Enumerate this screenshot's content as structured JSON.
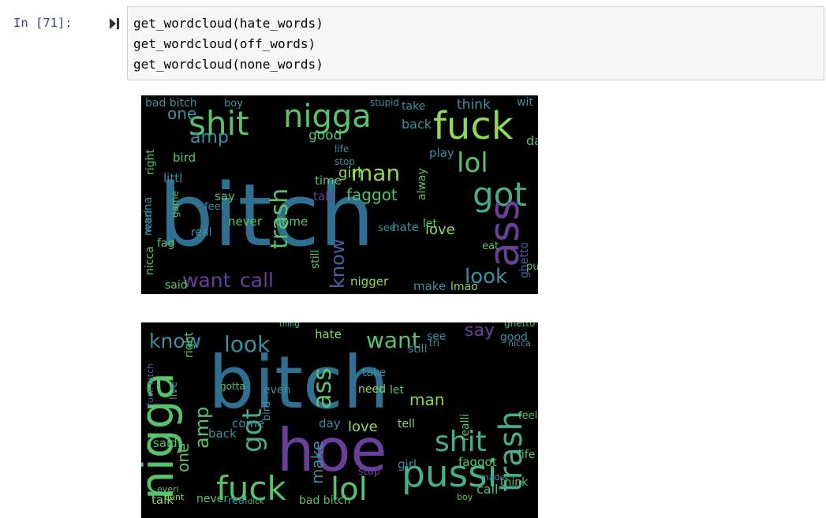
{
  "cell": {
    "prompt": "In [71]:",
    "run_icon": "step-run-icon",
    "code_lines": [
      "get_wordcloud(hate_words)",
      "get_wordcloud(off_words)",
      "get_wordcloud(none_words)"
    ]
  },
  "colors": {
    "prompt": "#303f9f",
    "cloud_background": "#000000",
    "palette": [
      "#2f6f8f",
      "#3b8fa2",
      "#58c26c",
      "#8fd85a",
      "#6a3f9a",
      "#3c2a6b",
      "#45b088",
      "#4a5fa0"
    ]
  },
  "clouds": [
    {
      "words": [
        {
          "text": "bitch",
          "c": 0
        },
        {
          "text": "hoe",
          "c": 3
        },
        {
          "text": "pussi",
          "c": 7
        },
        {
          "text": "shit",
          "c": 2
        },
        {
          "text": "nigga",
          "c": 2
        },
        {
          "text": "fuck",
          "c": 3
        },
        {
          "text": "lol",
          "c": 2
        },
        {
          "text": "got",
          "c": 6
        },
        {
          "text": "ass",
          "c": 4
        },
        {
          "text": "trash",
          "c": 2
        },
        {
          "text": "man",
          "c": 3
        },
        {
          "text": "look",
          "c": 1
        },
        {
          "text": "know",
          "c": 7
        },
        {
          "text": "want",
          "c": 4
        },
        {
          "text": "call",
          "c": 4
        },
        {
          "text": "amp",
          "c": 1
        },
        {
          "text": "one",
          "c": 1
        },
        {
          "text": "faggot",
          "c": 2
        },
        {
          "text": "love",
          "c": 3
        },
        {
          "text": "nigger",
          "c": 3
        },
        {
          "text": "make",
          "c": 1
        },
        {
          "text": "lmao",
          "c": 3
        },
        {
          "text": "hate",
          "c": 1
        },
        {
          "text": "girl",
          "c": 3
        },
        {
          "text": "good",
          "c": 2
        },
        {
          "text": "bird",
          "c": 2
        },
        {
          "text": "said",
          "c": 2
        },
        {
          "text": "play",
          "c": 1
        },
        {
          "text": "day",
          "c": 2
        },
        {
          "text": "real",
          "c": 1
        },
        {
          "text": "littl",
          "c": 1
        },
        {
          "text": "bad bitch",
          "c": 1
        },
        {
          "text": "think",
          "c": 1
        },
        {
          "text": "wit",
          "c": 1
        },
        {
          "text": "take",
          "c": 1
        },
        {
          "text": "back",
          "c": 1
        },
        {
          "text": "say",
          "c": 2
        },
        {
          "text": "time",
          "c": 2
        },
        {
          "text": "never",
          "c": 2
        },
        {
          "text": "come",
          "c": 2
        },
        {
          "text": "talk",
          "c": 4
        },
        {
          "text": "fag",
          "c": 2
        },
        {
          "text": "let",
          "c": 2
        },
        {
          "text": "see",
          "c": 1
        },
        {
          "text": "ghetto",
          "c": 7
        },
        {
          "text": "still",
          "c": 2
        },
        {
          "text": "alway",
          "c": 2
        },
        {
          "text": "need",
          "c": 1
        },
        {
          "text": "right",
          "c": 2
        },
        {
          "text": "wanna",
          "c": 1
        },
        {
          "text": "nicca",
          "c": 2
        },
        {
          "text": "boy",
          "c": 1
        },
        {
          "text": "stupid",
          "c": 1
        },
        {
          "text": "put",
          "c": 2
        },
        {
          "text": "eat",
          "c": 2
        },
        {
          "text": "feel",
          "c": 1
        },
        {
          "text": "game",
          "c": 2
        },
        {
          "text": "stop",
          "c": 1
        },
        {
          "text": "life",
          "c": 1
        }
      ]
    },
    {
      "words": [
        {
          "text": "bitch",
          "c": 0
        },
        {
          "text": "hoe",
          "c": 4
        },
        {
          "text": "nigga",
          "c": 2
        },
        {
          "text": "pussi",
          "c": 6
        },
        {
          "text": "fuck",
          "c": 2
        },
        {
          "text": "lol",
          "c": 2
        },
        {
          "text": "shit",
          "c": 6
        },
        {
          "text": "trash",
          "c": 6
        },
        {
          "text": "know",
          "c": 1
        },
        {
          "text": "look",
          "c": 1
        },
        {
          "text": "want",
          "c": 2
        },
        {
          "text": "ass",
          "c": 2
        },
        {
          "text": "got",
          "c": 6
        },
        {
          "text": "amp",
          "c": 2
        },
        {
          "text": "one",
          "c": 2
        },
        {
          "text": "man",
          "c": 3
        },
        {
          "text": "say",
          "c": 4
        },
        {
          "text": "make",
          "c": 1
        },
        {
          "text": "love",
          "c": 3
        },
        {
          "text": "need",
          "c": 3
        },
        {
          "text": "let",
          "c": 2
        },
        {
          "text": "girl",
          "c": 1
        },
        {
          "text": "faggot",
          "c": 2
        },
        {
          "text": "call",
          "c": 2
        },
        {
          "text": "think",
          "c": 2
        },
        {
          "text": "talk",
          "c": 3
        },
        {
          "text": "said",
          "c": 2
        },
        {
          "text": "back",
          "c": 1
        },
        {
          "text": "come",
          "c": 1
        },
        {
          "text": "day",
          "c": 1
        },
        {
          "text": "hate",
          "c": 3
        },
        {
          "text": "see",
          "c": 1
        },
        {
          "text": "still",
          "c": 1
        },
        {
          "text": "good",
          "c": 1
        },
        {
          "text": "tell",
          "c": 3
        },
        {
          "text": "take",
          "c": 1
        },
        {
          "text": "feel",
          "c": 2
        },
        {
          "text": "life",
          "c": 2
        },
        {
          "text": "bird",
          "c": 1
        },
        {
          "text": "even",
          "c": 1
        },
        {
          "text": "right",
          "c": 2
        },
        {
          "text": "stop",
          "c": 4
        },
        {
          "text": "bad bitch",
          "c": 2
        },
        {
          "text": "ghetto",
          "c": 2
        },
        {
          "text": "real",
          "c": 1
        },
        {
          "text": "never",
          "c": 2
        },
        {
          "text": "tri",
          "c": 1
        },
        {
          "text": "nicca",
          "c": 1
        },
        {
          "text": "realli",
          "c": 2
        },
        {
          "text": "fuck bitch",
          "c": 7
        },
        {
          "text": "thing",
          "c": 2
        },
        {
          "text": "live",
          "c": 1
        },
        {
          "text": "gotta",
          "c": 2
        },
        {
          "text": "everi",
          "c": 2
        },
        {
          "text": "made",
          "c": 1
        },
        {
          "text": "cunt",
          "c": 3
        },
        {
          "text": "boy",
          "c": 2
        },
        {
          "text": "dick",
          "c": 2
        }
      ]
    }
  ]
}
